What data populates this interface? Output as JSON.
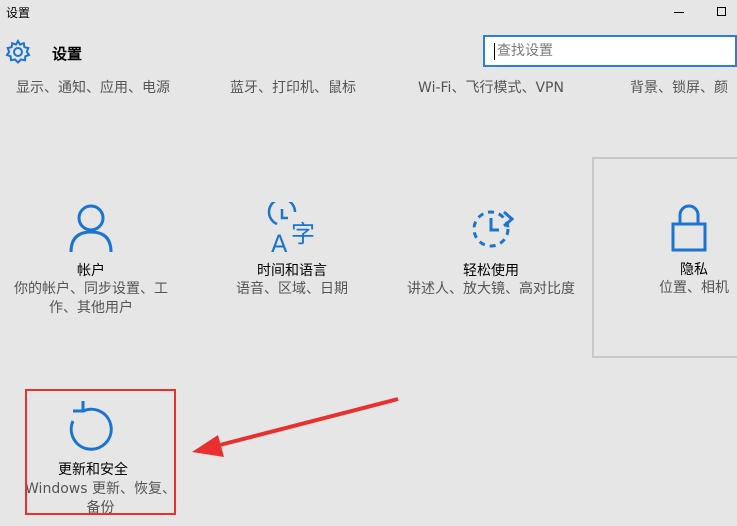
{
  "window": {
    "title": "设置"
  },
  "header": {
    "title": "设置"
  },
  "search": {
    "placeholder": "查找设置"
  },
  "top_row": [
    {
      "desc": "显示、通知、应用、电源"
    },
    {
      "desc": "蓝牙、打印机、鼠标"
    },
    {
      "desc": "Wi-Fi、飞行模式、VPN"
    },
    {
      "desc": "背景、锁屏、颜"
    }
  ],
  "tiles": [
    {
      "name": "帐户",
      "sub": "你的帐户、同步设置、工作、其他用户",
      "icon": "person-icon"
    },
    {
      "name": "时间和语言",
      "sub": "语音、区域、日期",
      "icon": "time-language-icon"
    },
    {
      "name": "轻松使用",
      "sub": "讲述人、放大镜、高对比度",
      "icon": "ease-of-access-icon"
    },
    {
      "name": "隐私",
      "sub": "位置、相机",
      "icon": "lock-icon"
    },
    {
      "name": "更新和安全",
      "sub": "Windows 更新、恢复、备份",
      "icon": "update-refresh-icon"
    }
  ],
  "colors": {
    "accent": "#1a74d0",
    "highlight": "#e8312f",
    "background": "#e6e6e6"
  }
}
